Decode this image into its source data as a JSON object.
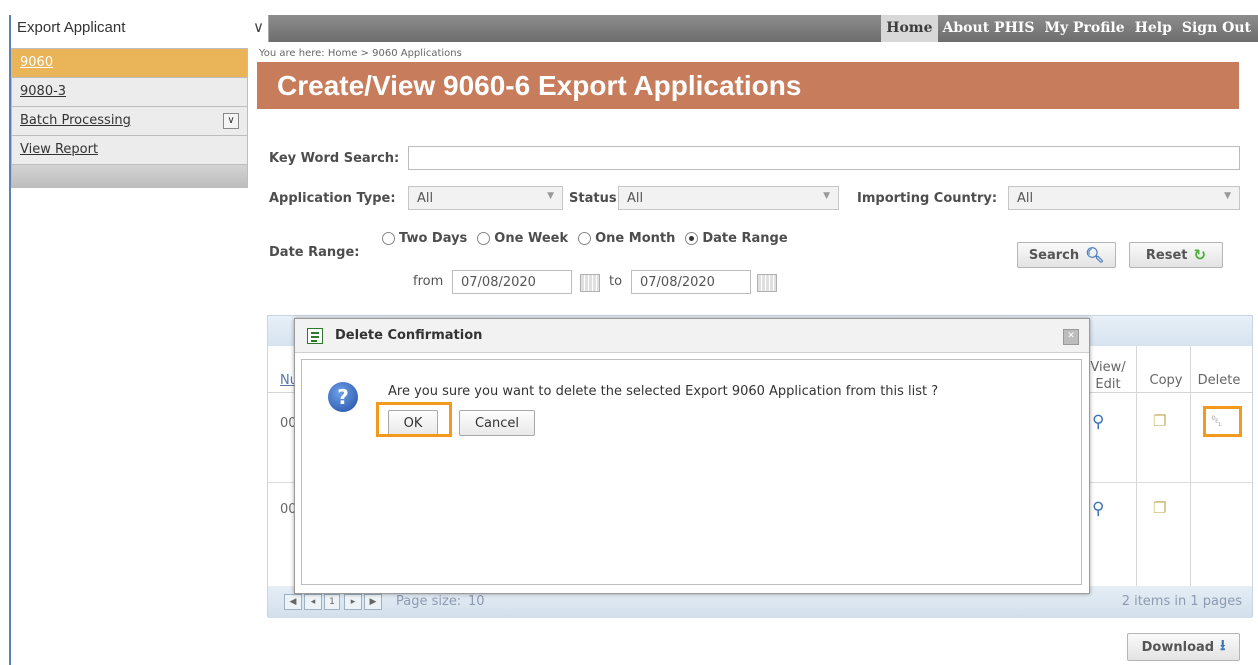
{
  "topbar": {
    "role_selector": "Export Applicant",
    "nav": [
      "Home",
      "About PHIS",
      "My Profile",
      "Help",
      "Sign Out"
    ]
  },
  "breadcrumb": "You are here: Home > 9060 Applications",
  "sidebar": {
    "items": [
      {
        "label": "9060",
        "active": true
      },
      {
        "label": "9080-3",
        "active": false
      },
      {
        "label": "Batch Processing",
        "active": false
      },
      {
        "label": "View Report",
        "active": false
      }
    ]
  },
  "page_title": "Create/View 9060-6 Export Applications",
  "filters": {
    "keyword_label": "Key Word Search:",
    "keyword_value": "",
    "app_type_label": "Application Type:",
    "app_type_value": "All",
    "status_label": "Status:",
    "status_value": "All",
    "country_label": "Importing Country:",
    "country_value": "All",
    "date_range_label": "Date Range:",
    "radios": [
      "Two Days",
      "One Week",
      "One Month",
      "Date Range"
    ],
    "selected_radio": "Date Range",
    "from_label": "from",
    "from_value": "07/08/2020",
    "to_label": "to",
    "to_value": "07/08/2020",
    "search_label": "Search",
    "reset_label": "Reset"
  },
  "grid": {
    "col_num_partial": "Nu",
    "col_view_edit": "View/\nEdit",
    "col_copy": "Copy",
    "col_delete": "Delete",
    "rows": [
      {
        "num_partial": "00"
      },
      {
        "num_partial": "00"
      }
    ],
    "pager": {
      "current_page": "1",
      "page_size_label": "Page size:",
      "page_size_value": "10",
      "summary": "2 items in 1 pages"
    }
  },
  "download_label": "Download",
  "dialog": {
    "title": "Delete Confirmation",
    "message": "Are you sure you want to delete the selected Export 9060 Application from this list ?",
    "ok_label": "OK",
    "cancel_label": "Cancel"
  },
  "colors": {
    "header_bg": "#c77c5b",
    "sidebar_active": "#eab458",
    "highlight": "#f39a1e",
    "frame_border": "#5a82b7"
  }
}
